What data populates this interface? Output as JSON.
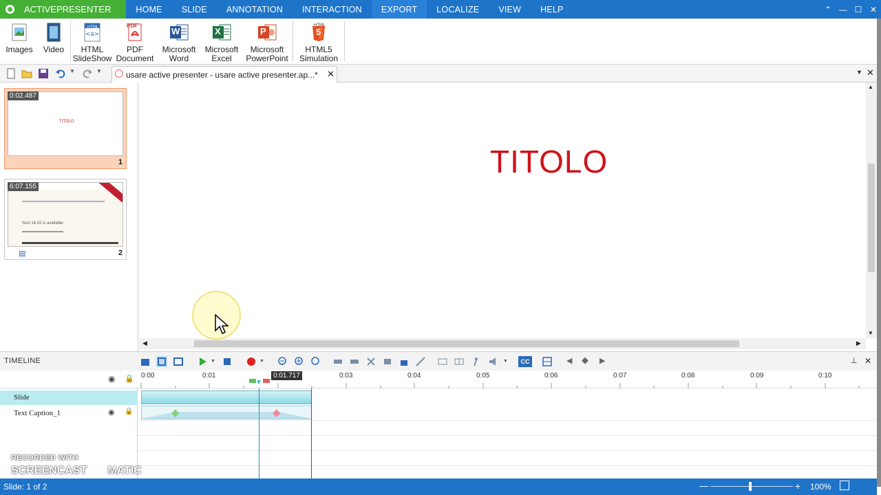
{
  "menubar": {
    "app": "ACTIVEPRESENTER",
    "items": [
      "HOME",
      "SLIDE",
      "ANNOTATION",
      "INTERACTION",
      "EXPORT",
      "LOCALIZE",
      "VIEW",
      "HELP"
    ],
    "active": "EXPORT"
  },
  "ribbon": {
    "buttons": [
      {
        "line1": "Images",
        "line2": ""
      },
      {
        "line1": "Video",
        "line2": ""
      },
      {
        "line1": "HTML",
        "line2": "SlideShow"
      },
      {
        "line1": "PDF",
        "line2": "Document"
      },
      {
        "line1": "Microsoft",
        "line2": "Word"
      },
      {
        "line1": "Microsoft",
        "line2": "Excel"
      },
      {
        "line1": "Microsoft",
        "line2": "PowerPoint"
      },
      {
        "line1": "HTML5",
        "line2": "Simulation"
      }
    ],
    "icon_labels": {
      "html": "HTML",
      "pdf": "PDF",
      "word": "W",
      "excel": "X",
      "ppt": "P",
      "html5": "5",
      "html5_top": "HTML"
    }
  },
  "doc_tab": {
    "title": "usare active presenter - usare active presenter.ap...*"
  },
  "slides": [
    {
      "duration": "0:02.487",
      "number": "1",
      "thumb_text": "TITOLO"
    },
    {
      "duration": "6:07.155",
      "number": "2",
      "thumb_text": "Sozi 16.02 is available"
    }
  ],
  "canvas": {
    "title": "TITOLO"
  },
  "timeline": {
    "label": "TIMELINE",
    "playhead": "0:01.717",
    "ticks": [
      "0:00",
      "0:01",
      "0:03",
      "0:04",
      "0:05",
      "0:06",
      "0:07",
      "0:08",
      "0:09",
      "0:10"
    ],
    "cc": "CC",
    "rows": [
      {
        "name": "Slide"
      },
      {
        "name": "Text Caption_1"
      }
    ]
  },
  "status": {
    "text": "Slide: 1 of 2",
    "zoom": "100%"
  },
  "watermark": {
    "line1": "RECORDED WITH",
    "line2": "SCREENCAST",
    "line3": "MATIC"
  },
  "colors": {
    "accent": "#1e74c9",
    "app": "#45b035",
    "title": "#d0121b"
  }
}
